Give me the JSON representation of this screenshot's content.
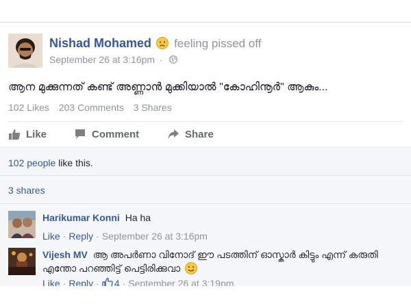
{
  "post": {
    "author": "Nishad Mohamed",
    "feeling": "feeling pissed off",
    "timestamp": "September 26 at 3:16pm",
    "separator": "·",
    "text": "ആന മുക്കുന്നത് കണ്ട് അണ്ണാൻ മുക്കിയാൽ \"കോഹിനൂർ\" ആകും...",
    "likes_count": "102 Likes",
    "comments_count": "203 Comments",
    "shares_count": "3 Shares"
  },
  "actions": {
    "like_label": "Like",
    "comment_label": "Comment",
    "share_label": "Share"
  },
  "summary": {
    "people_link": "102 people",
    "like_this": " like this.",
    "shares": "3 shares"
  },
  "comments": [
    {
      "name": "Harikumar Konni",
      "text": "Ha ha",
      "like": "Like",
      "reply": "Reply",
      "timestamp": "September 26 at 3:16pm"
    },
    {
      "name": "Vijesh MV",
      "text": "ആ അപർണാ വിനോദ് ഈ പടത്തിന് ഓസ്കാർ കിട്ടും എന്ന് കരുതി എന്തോ പറഞ്ഞിട്ട് പെട്ടിരിക്കുവാ",
      "like": "Like",
      "reply": "Reply",
      "reaction_count": "4",
      "timestamp": "September 26 at 3:19pm"
    }
  ],
  "colors": {
    "link": "#365899",
    "meta": "#90949c",
    "text": "#1d2129",
    "panel": "#f6f7f9"
  },
  "icons": {
    "feeling": "sad-face-icon",
    "privacy": "globe-icon",
    "like": "thumbs-up-icon",
    "comment": "comment-bubble-icon",
    "share": "share-arrow-icon",
    "smiley": "smiley-face-icon"
  }
}
